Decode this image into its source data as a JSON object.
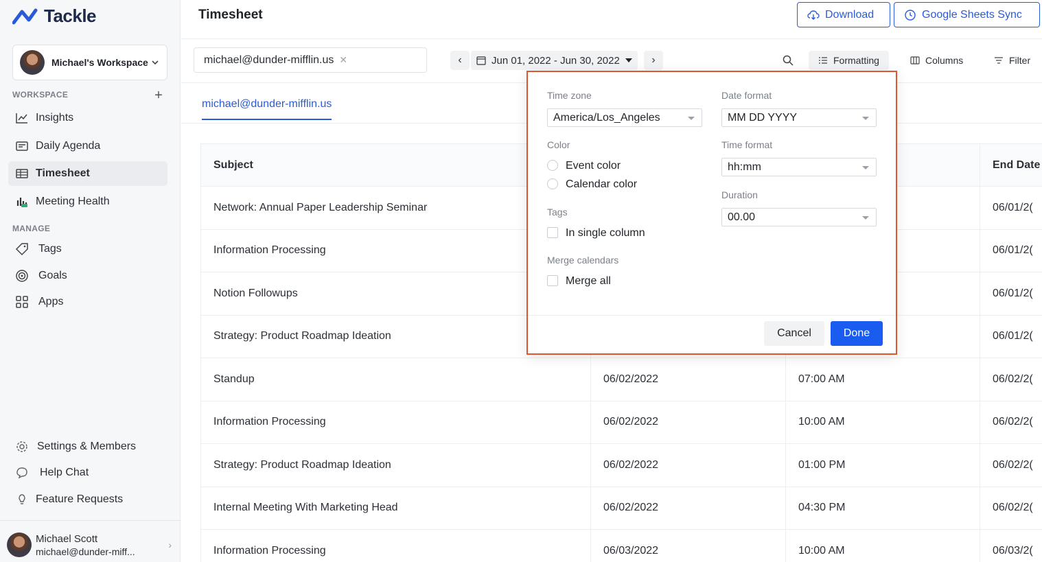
{
  "app": {
    "name": "Tackle"
  },
  "workspace": {
    "name": "Michael's Workspace"
  },
  "sidebar": {
    "workspace_label": "WORKSPACE",
    "manage_label": "MANAGE",
    "workspace_items": [
      {
        "label": "Insights",
        "icon": "chart-icon"
      },
      {
        "label": "Daily Agenda",
        "icon": "calendar-list-icon"
      },
      {
        "label": "Timesheet",
        "icon": "table-icon",
        "active": true
      },
      {
        "label": "Meeting Health",
        "icon": "bar-chart-icon"
      }
    ],
    "manage_items": [
      {
        "label": "Tags",
        "icon": "tag-icon"
      },
      {
        "label": "Goals",
        "icon": "target-icon"
      },
      {
        "label": "Apps",
        "icon": "apps-grid-icon"
      }
    ],
    "bottom_items": [
      {
        "label": "Settings & Members",
        "icon": "gear-icon"
      },
      {
        "label": "Help Chat",
        "icon": "chat-bubble-icon"
      },
      {
        "label": "Feature Requests",
        "icon": "lightbulb-icon"
      }
    ],
    "user": {
      "name": "Michael Scott",
      "email": "michael@dunder-miff..."
    }
  },
  "header": {
    "title": "Timesheet",
    "download_label": "Download",
    "sheets_label": "Google Sheets Sync"
  },
  "toolbar": {
    "email_chip": "michael@dunder-mifflin.us",
    "date_range": "Jun 01, 2022 - Jun 30, 2022",
    "formatting_label": "Formatting",
    "columns_label": "Columns",
    "filter_label": "Filter"
  },
  "tab": {
    "label": "michael@dunder-mifflin.us"
  },
  "table": {
    "headers": [
      "Subject",
      "",
      "",
      "End Date"
    ],
    "rows": [
      [
        "Network: Annual Paper Leadership Seminar",
        "",
        "",
        "06/01/2("
      ],
      [
        "Information Processing",
        "",
        "",
        "06/01/2("
      ],
      [
        "Notion Followups",
        "",
        "",
        "06/01/2("
      ],
      [
        "Strategy: Product Roadmap Ideation",
        "",
        "",
        "06/01/2("
      ],
      [
        "Standup",
        "06/02/2022",
        "07:00 AM",
        "06/02/2("
      ],
      [
        "Information Processing",
        "06/02/2022",
        "10:00 AM",
        "06/02/2("
      ],
      [
        "Strategy: Product Roadmap Ideation",
        "06/02/2022",
        "01:00 PM",
        "06/02/2("
      ],
      [
        "Internal Meeting With Marketing Head",
        "06/02/2022",
        "04:30 PM",
        "06/02/2("
      ],
      [
        "Information Processing",
        "06/03/2022",
        "10:00 AM",
        "06/03/2("
      ]
    ]
  },
  "formatting_popup": {
    "timezone_label": "Time zone",
    "timezone_value": "America/Los_Angeles",
    "date_format_label": "Date format",
    "date_format_value": "MM DD YYYY",
    "color_label": "Color",
    "color_options": [
      "Event color",
      "Calendar color"
    ],
    "time_format_label": "Time format",
    "time_format_value": "hh:mm",
    "duration_label": "Duration",
    "duration_value": "00.00",
    "tags_label": "Tags",
    "tags_option": "In single column",
    "merge_label": "Merge calendars",
    "merge_option": "Merge all",
    "cancel_label": "Cancel",
    "done_label": "Done"
  },
  "colors": {
    "accent": "#2a5bd7",
    "done_button": "#1a5cf0",
    "popup_highlight": "#e2532f"
  }
}
